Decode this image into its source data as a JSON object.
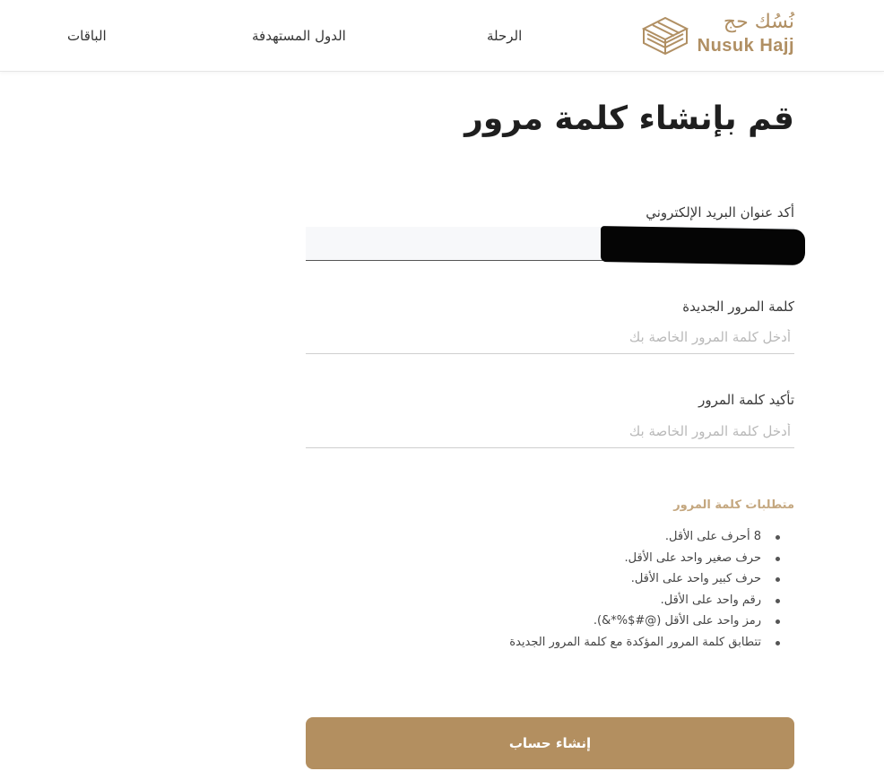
{
  "header": {
    "logo_arabic": "نُسُك حج",
    "logo_english": "Nusuk Hajj",
    "nav": [
      "الرحلة",
      "الدول المستهدفة",
      "الباقات"
    ]
  },
  "page": {
    "title": "قم بإنشاء كلمة مرور"
  },
  "form": {
    "email_label": "أكد عنوان البريد الإلكتروني",
    "email_value": "",
    "password_label": "كلمة المرور الجديدة",
    "password_placeholder": "أدخل كلمة المرور الخاصة بك",
    "confirm_label": "تأكيد كلمة المرور",
    "confirm_placeholder": "أدخل كلمة المرور الخاصة بك"
  },
  "requirements": {
    "title": "متطلبات كلمة المرور",
    "items": [
      "8 أحرف على الأقل.",
      "حرف صغير واحد على الأقل.",
      "حرف كبير واحد على الأقل.",
      "رقم واحد على الأقل.",
      "رمز واحد على الأقل (@#$%*&).",
      "تتطابق كلمة المرور المؤكدة مع كلمة المرور الجديدة"
    ]
  },
  "submit_label": "إنشاء حساب",
  "colors": {
    "brand": "#b08f63",
    "button": "#b38f60",
    "requirements_title": "#c4a77f"
  }
}
